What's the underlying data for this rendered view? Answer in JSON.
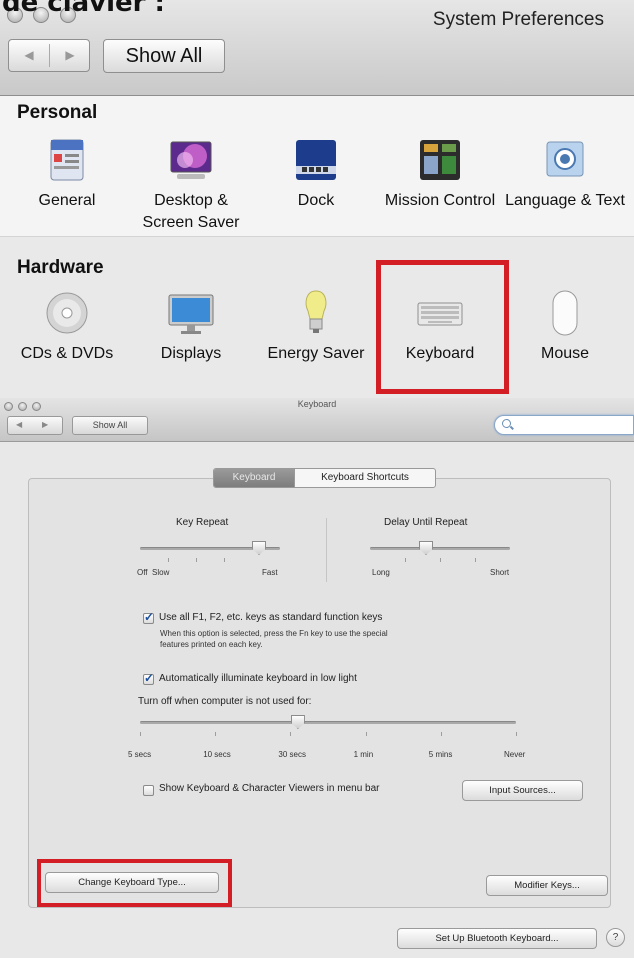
{
  "top_cut_text": "de clavier :",
  "prefs_window": {
    "title": "System Preferences",
    "nav_back": "◀",
    "nav_forward": "▶",
    "show_all": "Show All",
    "personal": {
      "heading": "Personal",
      "items": [
        {
          "label": "General",
          "icon": "general-icon"
        },
        {
          "label": "Desktop & Screen Saver",
          "icon": "desktop-icon"
        },
        {
          "label": "Dock",
          "icon": "dock-icon"
        },
        {
          "label": "Mission Control",
          "icon": "mission-control-icon"
        },
        {
          "label": "Language & Text",
          "icon": "language-icon"
        }
      ]
    },
    "hardware": {
      "heading": "Hardware",
      "items": [
        {
          "label": "CDs & DVDs",
          "icon": "cd-icon"
        },
        {
          "label": "Displays",
          "icon": "display-icon"
        },
        {
          "label": "Energy Saver",
          "icon": "bulb-icon"
        },
        {
          "label": "Keyboard",
          "icon": "keyboard-icon"
        },
        {
          "label": "Mouse",
          "icon": "mouse-icon"
        }
      ]
    }
  },
  "keyboard_window": {
    "title": "Keyboard",
    "show_all": "Show All",
    "search_placeholder": "",
    "tabs": {
      "keyboard": "Keyboard",
      "shortcuts": "Keyboard Shortcuts"
    },
    "key_repeat": {
      "title": "Key Repeat",
      "left": "Off",
      "left2": "Slow",
      "right": "Fast",
      "level": 0.85
    },
    "delay_until_repeat": {
      "title": "Delay Until Repeat",
      "left": "Long",
      "right": "Short",
      "level": 0.4
    },
    "fn_keys": {
      "label": "Use all F1, F2, etc. keys as standard function keys",
      "checked": true,
      "note1": "When this option is selected, press the Fn key to use the special",
      "note2": "features printed on each key."
    },
    "illuminate": {
      "label": "Automatically illuminate keyboard in low light",
      "checked": true
    },
    "turn_off": {
      "label": "Turn off when computer is not used for:",
      "ticks": [
        "5 secs",
        "10 secs",
        "30 secs",
        "1 min",
        "5 mins",
        "Never"
      ],
      "level": 0.42
    },
    "viewers": {
      "label": "Show Keyboard & Character Viewers in menu bar",
      "checked": false
    },
    "input_sources": "Input Sources...",
    "change_keyboard_type": "Change Keyboard Type...",
    "modifier_keys": "Modifier Keys...",
    "bluetooth": "Set Up Bluetooth Keyboard...",
    "help": "?"
  },
  "colors": {
    "highlight": "#d31e25"
  }
}
